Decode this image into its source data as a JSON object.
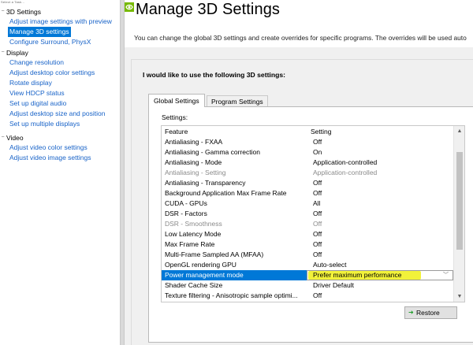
{
  "tree": {
    "top_caption": "Select a Task...",
    "groups": [
      {
        "label": "3D Settings",
        "toggle": "−",
        "items": [
          {
            "label": "Adjust image settings with preview",
            "selected": false
          },
          {
            "label": "Manage 3D settings",
            "selected": true
          },
          {
            "label": "Configure Surround, PhysX",
            "selected": false
          }
        ]
      },
      {
        "label": "Display",
        "toggle": "−",
        "items": [
          {
            "label": "Change resolution",
            "selected": false
          },
          {
            "label": "Adjust desktop color settings",
            "selected": false
          },
          {
            "label": "Rotate display",
            "selected": false
          },
          {
            "label": "View HDCP status",
            "selected": false
          },
          {
            "label": "Set up digital audio",
            "selected": false
          },
          {
            "label": "Adjust desktop size and position",
            "selected": false
          },
          {
            "label": "Set up multiple displays",
            "selected": false
          }
        ]
      },
      {
        "label": "Video",
        "toggle": "−",
        "items": [
          {
            "label": "Adjust video color settings",
            "selected": false
          },
          {
            "label": "Adjust video image settings",
            "selected": false
          }
        ]
      }
    ]
  },
  "header": {
    "title": "Manage 3D Settings",
    "description": "You can change the global 3D settings and create overrides for specific programs. The overrides will be used auto"
  },
  "panel": {
    "prompt": "I would like to use the following 3D settings:",
    "tabs": [
      {
        "label": "Global Settings",
        "active": true
      },
      {
        "label": "Program Settings",
        "active": false
      }
    ],
    "settings_caption": "Settings:",
    "columns": {
      "feature": "Feature",
      "setting": "Setting"
    },
    "rows": [
      {
        "feature": "Antialiasing - FXAA",
        "setting": "Off",
        "disabled": false,
        "selected": false
      },
      {
        "feature": "Antialiasing - Gamma correction",
        "setting": "On",
        "disabled": false,
        "selected": false
      },
      {
        "feature": "Antialiasing - Mode",
        "setting": "Application-controlled",
        "disabled": false,
        "selected": false
      },
      {
        "feature": "Antialiasing - Setting",
        "setting": "Application-controlled",
        "disabled": true,
        "selected": false
      },
      {
        "feature": "Antialiasing - Transparency",
        "setting": "Off",
        "disabled": false,
        "selected": false
      },
      {
        "feature": "Background Application Max Frame Rate",
        "setting": "Off",
        "disabled": false,
        "selected": false
      },
      {
        "feature": "CUDA - GPUs",
        "setting": "All",
        "disabled": false,
        "selected": false
      },
      {
        "feature": "DSR - Factors",
        "setting": "Off",
        "disabled": false,
        "selected": false
      },
      {
        "feature": "DSR - Smoothness",
        "setting": "Off",
        "disabled": true,
        "selected": false
      },
      {
        "feature": "Low Latency Mode",
        "setting": "Off",
        "disabled": false,
        "selected": false
      },
      {
        "feature": "Max Frame Rate",
        "setting": "Off",
        "disabled": false,
        "selected": false
      },
      {
        "feature": "Multi-Frame Sampled AA (MFAA)",
        "setting": "Off",
        "disabled": false,
        "selected": false
      },
      {
        "feature": "OpenGL rendering GPU",
        "setting": "Auto-select",
        "disabled": false,
        "selected": false
      },
      {
        "feature": "Power management mode",
        "setting": "Prefer maximum performance",
        "disabled": false,
        "selected": true
      },
      {
        "feature": "Shader Cache Size",
        "setting": "Driver Default",
        "disabled": false,
        "selected": false
      },
      {
        "feature": "Texture filtering - Anisotropic sample optimi...",
        "setting": "Off",
        "disabled": false,
        "selected": false
      }
    ],
    "restore_label": "Restore"
  },
  "colors": {
    "selection": "#0078d7",
    "link": "#1863c8",
    "highlight": "#f2f23a",
    "nvidia_green": "#76b900"
  },
  "icons": {
    "restore": "green-arrow-icon",
    "app": "nvidia-logo-icon"
  }
}
